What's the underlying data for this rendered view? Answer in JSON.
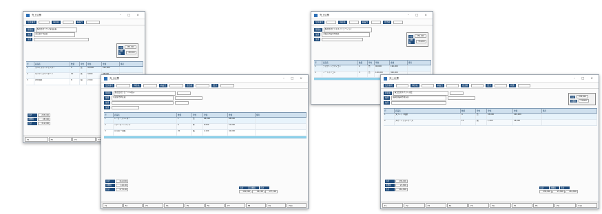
{
  "windows": [
    {
      "id": "w1",
      "title": "売上伝票",
      "header_labels": [
        "伝票番号",
        "得意先",
        "納品日"
      ],
      "company": "株式会社テクノ情報商事",
      "address": "東京都千代田区",
      "grid_headers": [
        "行",
        "商品名",
        "数量",
        "単位",
        "単価",
        "金額",
        "備考"
      ],
      "rows": [
        {
          "no": "1",
          "code": "12345",
          "name": "ウルトラワイドモニター",
          "qty": "5",
          "unit": "台",
          "price": "45,000",
          "amount": "225,000"
        },
        {
          "no": "2",
          "code": "23456",
          "name": "ワイヤレスキーボード",
          "qty": "10",
          "unit": "台",
          "price": "3,800",
          "amount": "38,000"
        },
        {
          "no": "3",
          "code": "34567",
          "name": "LED照明",
          "qty": "8",
          "unit": "個",
          "price": "2,500",
          "amount": "20,000"
        }
      ],
      "totals": {
        "subtotal": "283,000",
        "tax": "28,300",
        "total": "311,300"
      },
      "fkeys": [
        "F1",
        "F2",
        "F3",
        "F4",
        "F5"
      ]
    },
    {
      "id": "w2",
      "title": "売上伝票",
      "header_labels": [
        "伝票番号",
        "得意先",
        "納品日",
        "担当者"
      ],
      "company": "株式会社ビジネスソリューション",
      "address": "大阪府大阪市中央区",
      "grid_headers": [
        "行",
        "商品名",
        "数量",
        "単位",
        "単価",
        "金額",
        "備考"
      ],
      "rows": [
        {
          "no": "1",
          "code": "45678",
          "name": "デスクトップパソコン",
          "qty": "2",
          "unit": "台",
          "price": "98,000",
          "amount": "196,000"
        },
        {
          "no": "2",
          "code": "56789",
          "name": "ノートパソコン",
          "qty": "3",
          "unit": "台",
          "price": "120,000",
          "amount": "360,000"
        }
      ],
      "totals": {
        "subtotal": "556,000",
        "tax": "55,600",
        "total": "611,600"
      },
      "fkeys": [
        "F1",
        "F2",
        "F3",
        "F4",
        "F5"
      ]
    },
    {
      "id": "w3",
      "title": "売上伝票",
      "header_labels": [
        "伝票番号",
        "得意先",
        "納品日",
        "担当者",
        "区分"
      ],
      "company": "株式会社グローバル電子",
      "address": "名古屋市中区栄",
      "grid_headers": [
        "行",
        "商品名",
        "数量",
        "単位",
        "単価",
        "金額",
        "備考"
      ],
      "rows": [
        {
          "no": "1",
          "code": "12345",
          "name": "レーザープリンター",
          "qty": "1",
          "unit": "台",
          "price": "68,000",
          "amount": "68,000"
        },
        {
          "no": "2",
          "code": "23456",
          "name": "トナーカートリッジ",
          "qty": "6",
          "unit": "本",
          "price": "8,500",
          "amount": "51,000"
        },
        {
          "no": "3",
          "code": "34567",
          "name": "A4コピー用紙",
          "qty": "20",
          "unit": "箱",
          "price": "2,100",
          "amount": "42,000"
        }
      ],
      "totals": {
        "subtotal": "161,000",
        "tax": "16,100",
        "total": "177,100"
      },
      "fkeys": [
        "F1",
        "F2",
        "F3",
        "F4",
        "F5",
        "F6",
        "F7",
        "F8",
        "F9",
        "F10"
      ]
    },
    {
      "id": "w4",
      "title": "売上伝票",
      "header_labels": [
        "伝票番号",
        "得意先",
        "納品日",
        "担当者",
        "区分",
        "状態"
      ],
      "company": "株式会社ネクスト商会",
      "address": "福岡県福岡市博多区",
      "grid_headers": [
        "行",
        "商品名",
        "数量",
        "単位",
        "単価",
        "金額",
        "備考"
      ],
      "rows": [
        {
          "no": "1",
          "code": "78901",
          "name": "タブレット端末",
          "qty": "4",
          "unit": "台",
          "price": "55,000",
          "amount": "220,000"
        },
        {
          "no": "2",
          "code": "89012",
          "name": "スマートフォンケース",
          "qty": "15",
          "unit": "個",
          "price": "1,200",
          "amount": "18,000"
        }
      ],
      "totals": {
        "subtotal": "238,000",
        "tax": "23,800",
        "total": "261,800"
      },
      "fkeys": [
        "F1",
        "F2",
        "F3",
        "F4",
        "F5",
        "F6",
        "F7",
        "F8",
        "F9",
        "F10"
      ]
    }
  ],
  "labels": {
    "subtotal": "小計",
    "tax": "消費税",
    "total": "合計",
    "customer": "得意先",
    "address": "住所"
  }
}
